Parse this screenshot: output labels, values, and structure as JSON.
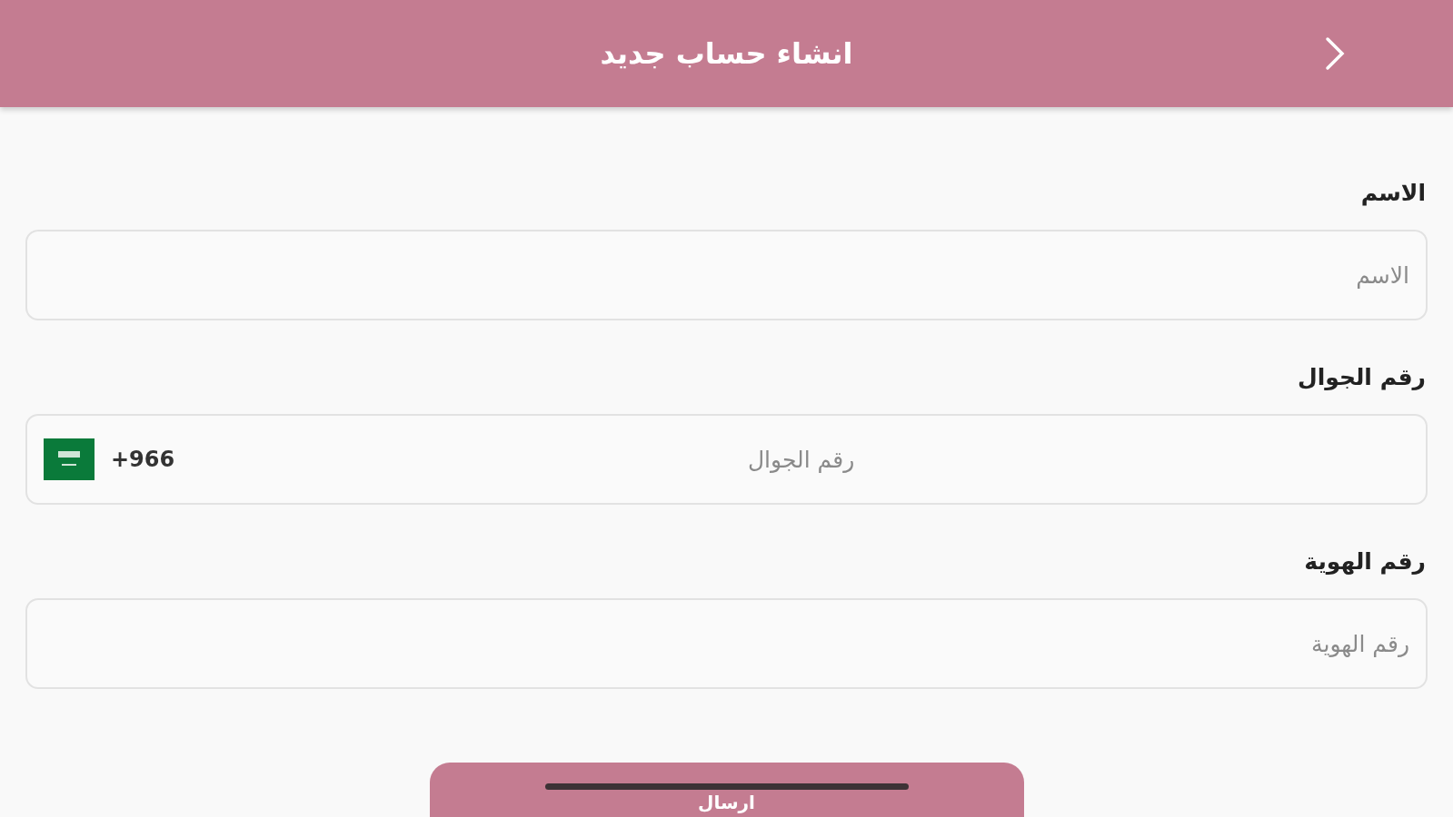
{
  "header": {
    "title": "انشاء حساب جديد"
  },
  "fields": [
    {
      "kind": "text",
      "label": "الاسم",
      "placeholder": "الاسم"
    },
    {
      "kind": "phone",
      "label": "رقم الجوال",
      "placeholder": "رقم الجوال",
      "country_code": "+966"
    },
    {
      "kind": "text",
      "label": "رقم الهوية",
      "placeholder": "رقم الهوية"
    }
  ],
  "submit_button": {
    "label": "ارسال"
  }
}
